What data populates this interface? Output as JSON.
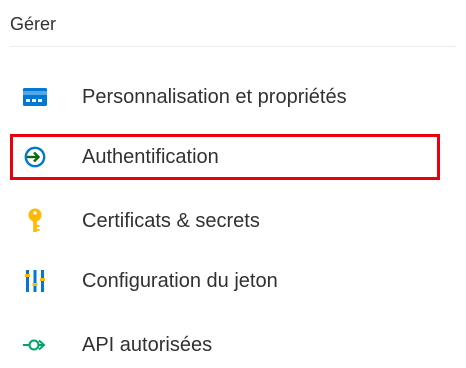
{
  "section": {
    "title": "Gérer"
  },
  "nav": {
    "items": [
      {
        "label": "Personnalisation et propriétés",
        "icon": "branding-card-icon",
        "active": false
      },
      {
        "label": "Authentification",
        "icon": "authentication-arrow-icon",
        "active": true
      },
      {
        "label": "Certificats & secrets",
        "icon": "key-icon",
        "active": false
      },
      {
        "label": "Configuration du jeton",
        "icon": "token-bars-icon",
        "active": false
      },
      {
        "label": "API autorisées",
        "icon": "api-arrow-icon",
        "active": false
      }
    ]
  },
  "colors": {
    "highlight_border": "#e8000d",
    "auth_icon": "#0078d4",
    "key_icon": "#ffb900",
    "token_icon": "#0078d4",
    "api_icon": "#00a36c",
    "branding_icon": "#0078d4"
  }
}
